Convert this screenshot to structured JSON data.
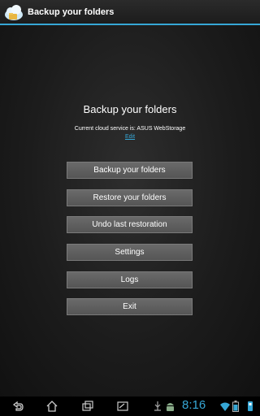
{
  "titlebar": {
    "title": "Backup your folders"
  },
  "main": {
    "heading": "Backup your folders",
    "service_text": "Current cloud service is: ASUS WebStorage",
    "edit_label": "Edit",
    "buttons": [
      {
        "label": "Backup your folders"
      },
      {
        "label": "Restore your folders"
      },
      {
        "label": "Undo last restoration"
      },
      {
        "label": "Settings"
      },
      {
        "label": "Logs"
      },
      {
        "label": "Exit"
      }
    ]
  },
  "navbar": {
    "clock": "8:16",
    "icons": [
      "back-icon",
      "home-icon",
      "recent-apps-icon",
      "screenshot-icon",
      "usb-debug-icon",
      "android-icon",
      "wifi-icon",
      "battery-icon"
    ]
  },
  "colors": {
    "accent": "#36a7d6",
    "button": "#5e5e5e",
    "background": "#1c1c1c"
  }
}
